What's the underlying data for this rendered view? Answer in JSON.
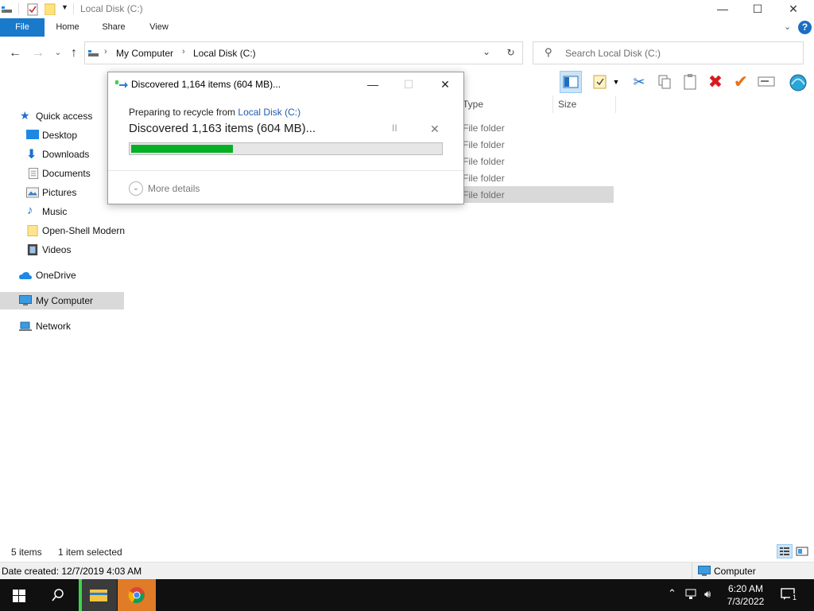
{
  "window": {
    "title": "Local Disk (C:)",
    "minimize": "—",
    "maximize": "☐",
    "close": "✕"
  },
  "ribbon": {
    "tabs": [
      "File",
      "Home",
      "Share",
      "View"
    ],
    "expand_icon": "chevron-down-icon",
    "help": "?"
  },
  "address": {
    "breadcrumbs": [
      "My Computer",
      "Local Disk (C:)"
    ],
    "search_placeholder": "Search Local Disk (C:)"
  },
  "sidebar": {
    "items": [
      {
        "label": "Quick access",
        "icon": "star-icon"
      },
      {
        "label": "Desktop",
        "icon": "desktop-icon"
      },
      {
        "label": "Downloads",
        "icon": "download-icon"
      },
      {
        "label": "Documents",
        "icon": "documents-icon"
      },
      {
        "label": "Pictures",
        "icon": "pictures-icon"
      },
      {
        "label": "Music",
        "icon": "music-icon"
      },
      {
        "label": "Open-Shell Modern",
        "icon": "folder-icon"
      },
      {
        "label": "Videos",
        "icon": "videos-icon"
      },
      {
        "label": "OneDrive",
        "icon": "cloud-icon"
      },
      {
        "label": "My Computer",
        "icon": "computer-icon"
      },
      {
        "label": "Network",
        "icon": "network-icon"
      }
    ]
  },
  "content": {
    "columns": [
      "Type",
      "Size"
    ],
    "rows": [
      {
        "type": "File folder"
      },
      {
        "type": "File folder"
      },
      {
        "type": "File folder"
      },
      {
        "type": "File folder"
      },
      {
        "type": "File folder"
      }
    ]
  },
  "status": {
    "item_count": "5 items",
    "selected": "1 item selected"
  },
  "details": {
    "date_created": "Date created: 12/7/2019 4:03 AM",
    "location": "Computer"
  },
  "dialog": {
    "title": "Discovered 1,164 items (604 MB)...",
    "preparing_prefix": "Preparing to recycle from ",
    "preparing_link": "Local Disk (C:)",
    "big_status": "Discovered 1,163 items (604 MB)...",
    "pause_glyph": "II",
    "cancel_glyph": "✕",
    "progress_fraction": 0.33,
    "progress_color": "#06b025",
    "more_details": "More details"
  },
  "taskbar": {
    "time": "6:20 AM",
    "date": "7/3/2022",
    "notification_count": "1"
  }
}
